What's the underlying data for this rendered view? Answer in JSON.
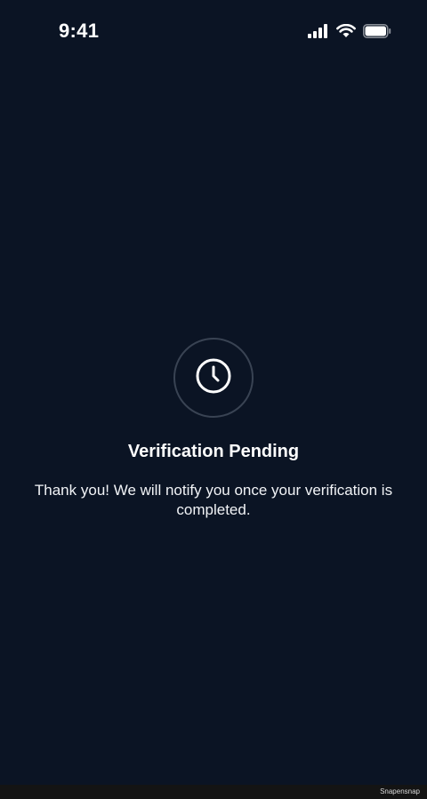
{
  "status_bar": {
    "time": "9:41",
    "icons": [
      "cellular-signal-icon",
      "wifi-icon",
      "battery-icon"
    ]
  },
  "verification": {
    "icon": "clock-icon",
    "title": "Verification Pending",
    "message": "Thank you! We will notify you once your verification is completed."
  },
  "footer": {
    "watermark": "Snapensnap"
  },
  "colors": {
    "background": "#0b1424",
    "text": "#ffffff",
    "ring": "#394353",
    "bottom_bar": "#141414"
  }
}
